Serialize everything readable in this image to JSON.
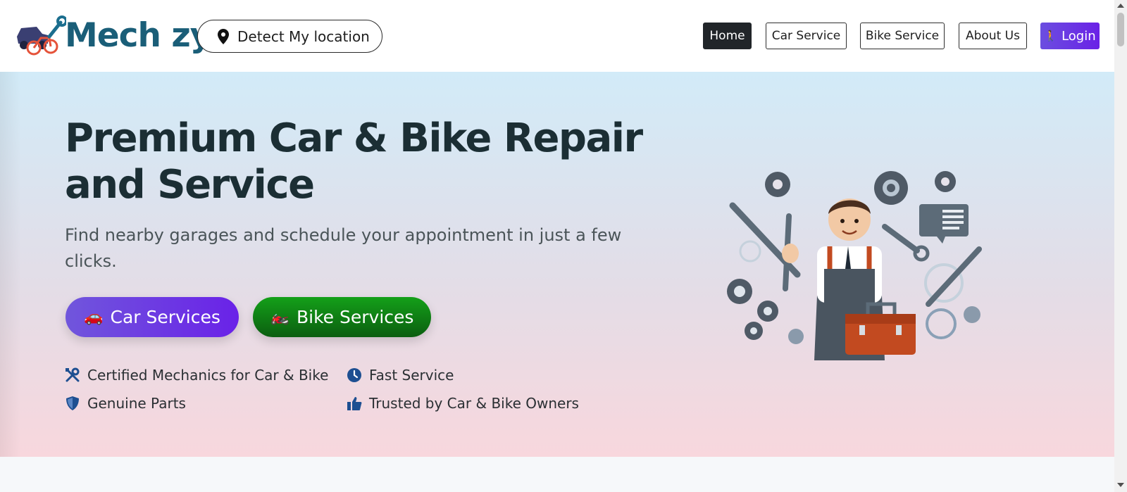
{
  "brand": {
    "name": "Mech zy",
    "logo_icon": "car-bike-wrench-logo"
  },
  "location": {
    "label": "Detect My location",
    "icon": "map-pin-icon"
  },
  "nav": {
    "home": "Home",
    "car_service": "Car Service",
    "bike_service": "Bike Service",
    "about": "About Us",
    "login": "Login",
    "login_icon": "person-walking-emoji"
  },
  "hero": {
    "title": "Premium Car & Bike Repair and Service",
    "subtitle": "Find nearby garages and schedule your appointment in just a few clicks.",
    "car_button": {
      "emoji": "🚗",
      "label": "Car Services"
    },
    "bike_button": {
      "emoji": "🏍️",
      "label": "Bike Services"
    },
    "features": [
      {
        "icon": "tools-icon",
        "label": "Certified Mechanics for Car & Bike"
      },
      {
        "icon": "clock-icon",
        "label": "Fast Service"
      },
      {
        "icon": "shield-icon",
        "label": "Genuine Parts"
      },
      {
        "icon": "thumbs-up-icon",
        "label": "Trusted by Car & Bike Owners"
      }
    ],
    "illustration": "mechanic-with-toolbox-illustration"
  },
  "colors": {
    "brand_teal": "#1a5e78",
    "login_purple": "#6a21e6",
    "bike_green": "#0f8a14",
    "icon_blue": "#1d4f91"
  }
}
